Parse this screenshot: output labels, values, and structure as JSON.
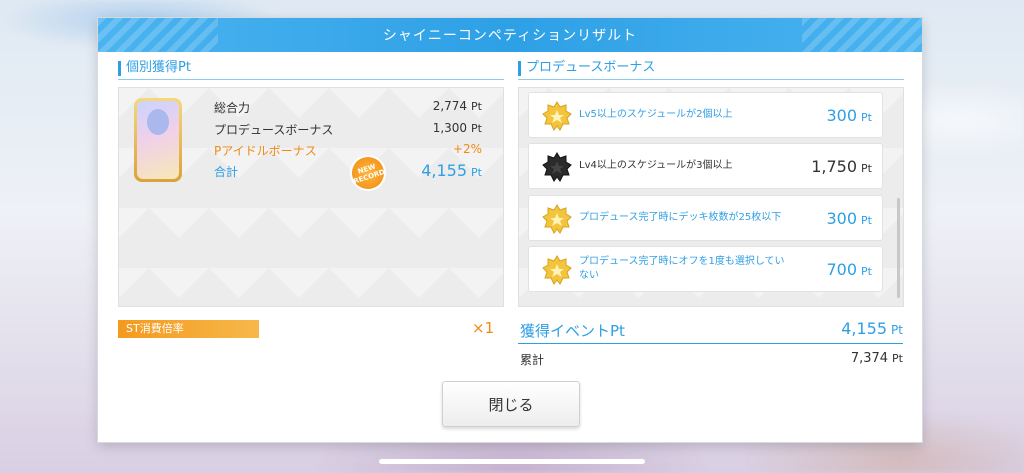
{
  "title": "シャイニーコンペティションリザルト",
  "individual": {
    "header": "個別獲得Pt",
    "rows": [
      {
        "label": "総合力",
        "value": "2,774",
        "unit": "Pt"
      },
      {
        "label": "プロデュースボーナス",
        "value": "1,300",
        "unit": "Pt"
      },
      {
        "label": "Pアイドルボーナス",
        "value": "+2%",
        "unit": ""
      },
      {
        "label": "合計",
        "value": "4,155",
        "unit": "Pt"
      }
    ],
    "badge": "NEW RECORD"
  },
  "produce_bonus": {
    "header": "プロデュースボーナス",
    "items": [
      {
        "text": "Lv5以上のスケジュールが2個以上",
        "value": "300",
        "unit": "Pt",
        "icon": "gold-star-medal-icon"
      },
      {
        "text": "Lv4以上のスケジュールが3個以上",
        "value": "1,750",
        "unit": "Pt",
        "icon": "dark-star-medal-icon"
      },
      {
        "text": "プロデュース完了時にデッキ枚数が25枚以下",
        "value": "300",
        "unit": "Pt",
        "icon": "gold-star-medal-icon"
      },
      {
        "text": "プロデュース完了時にオフを1度も選択していない",
        "value": "700",
        "unit": "Pt",
        "icon": "gold-star-medal-icon"
      }
    ]
  },
  "st_rate": {
    "label": "ST消費倍率",
    "value": "×1"
  },
  "event_pt": {
    "label": "獲得イベントPt",
    "value": "4,155",
    "unit": "Pt"
  },
  "cumulative": {
    "label": "累計",
    "value": "7,374",
    "unit": "Pt"
  },
  "close_label": "閉じる",
  "colors": {
    "accent": "#2f9fe4",
    "orange": "#f08a14"
  }
}
